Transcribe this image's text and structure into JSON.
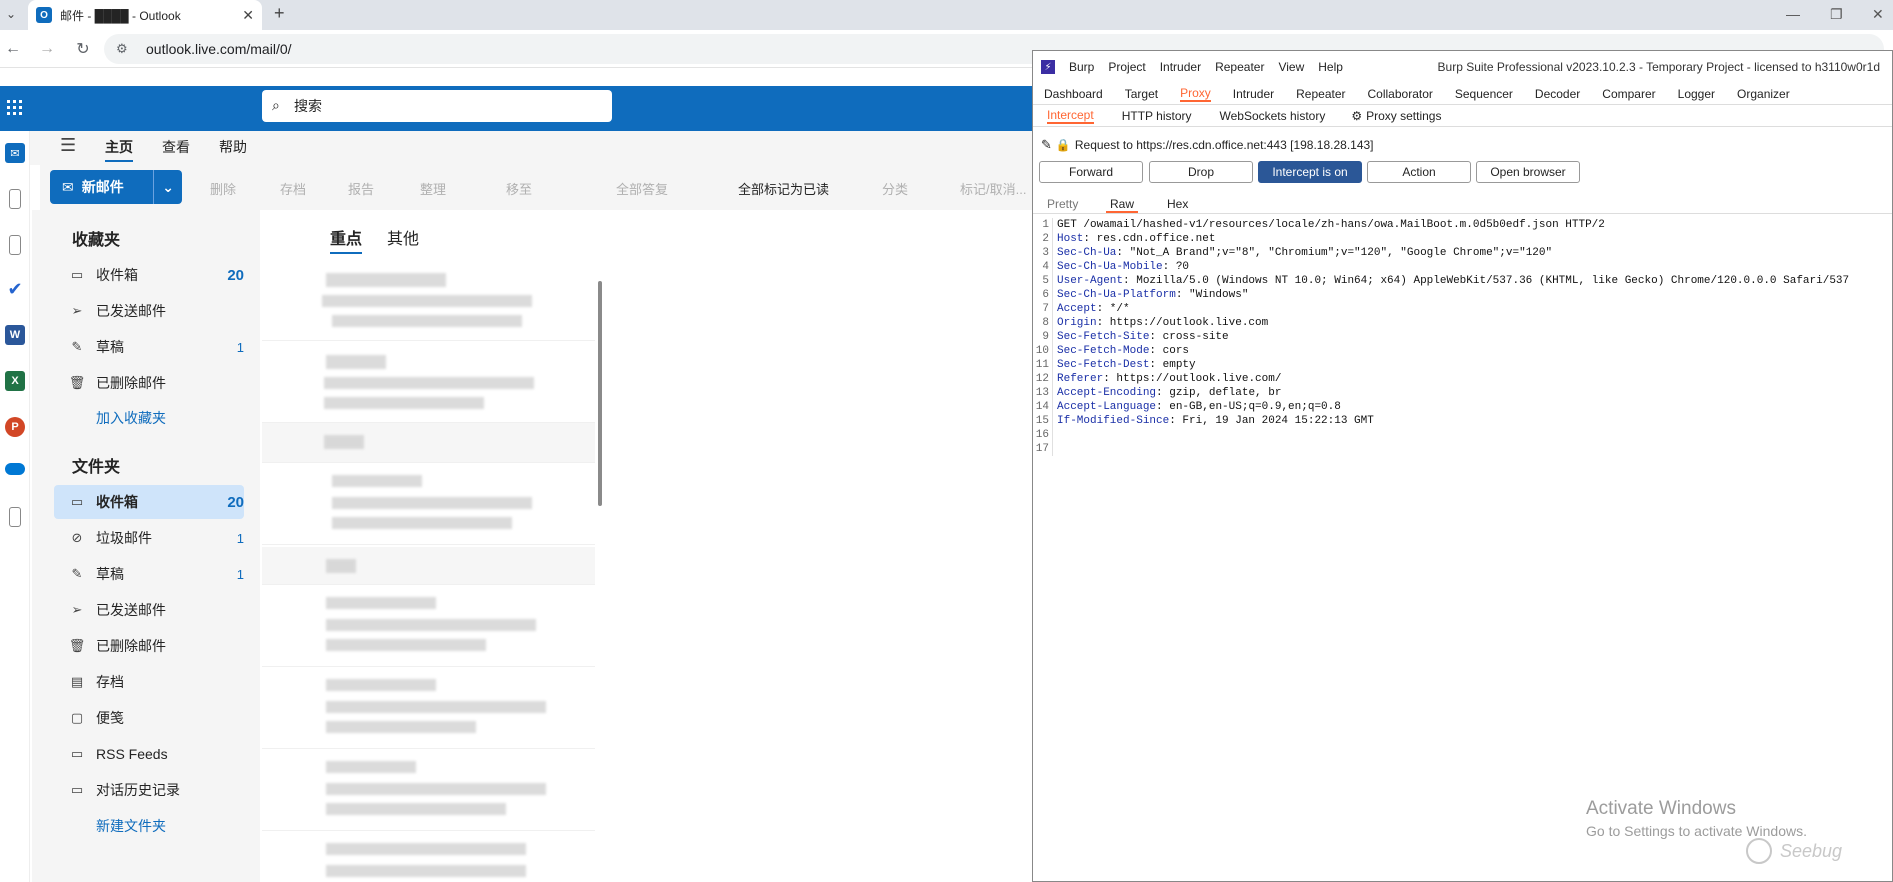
{
  "browser": {
    "tab_title": "邮件 - ████ - Outlook",
    "tab_favicon": "O",
    "url": "outlook.live.com/mail/0/",
    "close_tab": "✕",
    "new_tab": "+"
  },
  "outlook": {
    "search_placeholder": "搜索",
    "ribbon_tabs": [
      "主页",
      "查看",
      "帮助"
    ],
    "new_mail": "新邮件",
    "actions": [
      "删除",
      "存档",
      "报告",
      "整理",
      "移至",
      "全部答复",
      "全部标记为已读",
      "分类",
      "标记/取消..."
    ],
    "favorites": {
      "header": "收藏夹",
      "items": [
        {
          "label": "收件箱",
          "count": "20",
          "icon": "inbox-icon"
        },
        {
          "label": "已发送邮件",
          "count": "",
          "icon": "send-icon"
        },
        {
          "label": "草稿",
          "count": "1",
          "icon": "draft-icon"
        },
        {
          "label": "已删除邮件",
          "count": "",
          "icon": "trash-icon"
        }
      ],
      "add_link": "加入收藏夹"
    },
    "folders": {
      "header": "文件夹",
      "items": [
        {
          "label": "收件箱",
          "count": "20",
          "icon": "inbox-icon"
        },
        {
          "label": "垃圾邮件",
          "count": "1",
          "icon": "junk-icon"
        },
        {
          "label": "草稿",
          "count": "1",
          "icon": "draft-icon"
        },
        {
          "label": "已发送邮件",
          "count": "",
          "icon": "send-icon"
        },
        {
          "label": "已删除邮件",
          "count": "",
          "icon": "trash-icon"
        },
        {
          "label": "存档",
          "count": "",
          "icon": "archive-icon"
        },
        {
          "label": "便笺",
          "count": "",
          "icon": "note-icon"
        },
        {
          "label": "RSS Feeds",
          "count": "",
          "icon": "folder-icon"
        },
        {
          "label": "对话历史记录",
          "count": "",
          "icon": "folder-icon"
        }
      ],
      "new_link": "新建文件夹"
    },
    "mail_tabs": [
      "重点",
      "其他"
    ]
  },
  "burp": {
    "menu": [
      "Burp",
      "Project",
      "Intruder",
      "Repeater",
      "View",
      "Help"
    ],
    "title": "Burp Suite Professional v2023.10.2.3 - Temporary Project - licensed to h3110w0r1d",
    "tabs": [
      "Dashboard",
      "Target",
      "Proxy",
      "Intruder",
      "Repeater",
      "Collaborator",
      "Sequencer",
      "Decoder",
      "Comparer",
      "Logger",
      "Organizer"
    ],
    "subtabs": [
      "Intercept",
      "HTTP history",
      "WebSockets history",
      "Proxy settings"
    ],
    "request_info": "Request to https://res.cdn.office.net:443  [198.18.28.143]",
    "buttons": [
      "Forward",
      "Drop",
      "Intercept is on",
      "Action",
      "Open browser"
    ],
    "view_tabs": [
      "Pretty",
      "Raw",
      "Hex"
    ],
    "request_lines": [
      {
        "k": "",
        "v": "GET /owamail/hashed-v1/resources/locale/zh-hans/owa.MailBoot.m.0d5b0edf.json HTTP/2"
      },
      {
        "k": "Host",
        "v": ": res.cdn.office.net"
      },
      {
        "k": "Sec-Ch-Ua",
        "v": ": \"Not_A Brand\";v=\"8\", \"Chromium\";v=\"120\", \"Google Chrome\";v=\"120\""
      },
      {
        "k": "Sec-Ch-Ua-Mobile",
        "v": ": ?0"
      },
      {
        "k": "User-Agent",
        "v": ": Mozilla/5.0 (Windows NT 10.0; Win64; x64) AppleWebKit/537.36 (KHTML, like Gecko) Chrome/120.0.0.0 Safari/537"
      },
      {
        "k": "Sec-Ch-Ua-Platform",
        "v": ": \"Windows\""
      },
      {
        "k": "Accept",
        "v": ": */*"
      },
      {
        "k": "Origin",
        "v": ": https://outlook.live.com"
      },
      {
        "k": "Sec-Fetch-Site",
        "v": ": cross-site"
      },
      {
        "k": "Sec-Fetch-Mode",
        "v": ": cors"
      },
      {
        "k": "Sec-Fetch-Dest",
        "v": ": empty"
      },
      {
        "k": "Referer",
        "v": ": https://outlook.live.com/"
      },
      {
        "k": "Accept-Encoding",
        "v": ": gzip, deflate, br"
      },
      {
        "k": "Accept-Language",
        "v": ": en-GB,en-US;q=0.9,en;q=0.8"
      },
      {
        "k": "If-Modified-Since",
        "v": ": Fri, 19 Jan 2024 15:22:13 GMT"
      },
      {
        "k": "",
        "v": ""
      },
      {
        "k": "",
        "v": ""
      }
    ]
  },
  "overlay": {
    "activate_title": "Activate Windows",
    "activate_sub": "Go to Settings to activate Windows.",
    "watermark": "Seebug"
  },
  "colors": {
    "outlook_blue": "#0f6cbd",
    "burp_orange": "#ff6633",
    "burp_button": "#2b5797"
  }
}
